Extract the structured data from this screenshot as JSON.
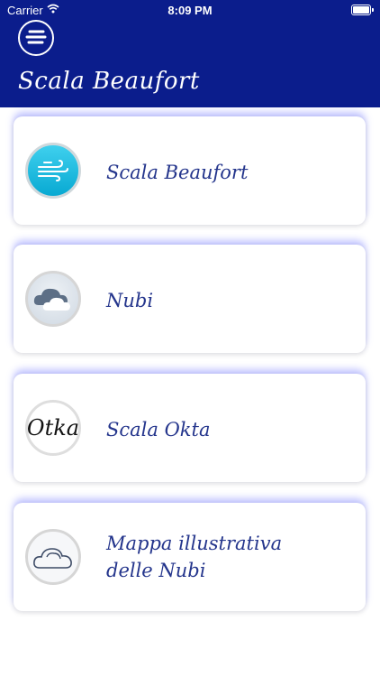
{
  "status_bar": {
    "carrier": "Carrier",
    "time": "8:09 PM"
  },
  "header": {
    "title": "Scala Beaufort",
    "menu_icon": "menu-lines-icon",
    "background": "#0b1d8c"
  },
  "cards": [
    {
      "label": "Scala Beaufort",
      "icon": "wind-icon"
    },
    {
      "label": "Nubi",
      "icon": "cloud-icon"
    },
    {
      "label": "Scala Okta",
      "icon": "otka-icon",
      "icon_text": "Otka"
    },
    {
      "label_line1": "Mappa illustrativa",
      "label_line2": "delle Nubi",
      "icon": "cloud-outline-icon"
    }
  ]
}
